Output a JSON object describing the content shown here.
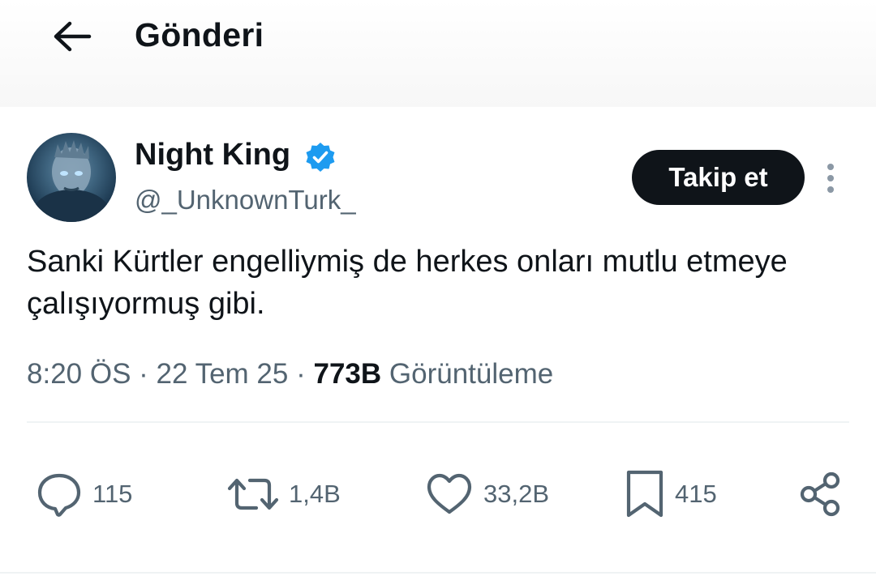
{
  "header": {
    "title": "Gönderi",
    "back_icon": "arrow-left-icon"
  },
  "author": {
    "display_name": "Night King",
    "handle": "@_UnknownTurk_",
    "verified": true,
    "verified_color": "#1d9bf0"
  },
  "follow_button": {
    "label": "Takip et"
  },
  "tweet": {
    "text": "Sanki Kürtler engelliymiş de herkes onları mutlu etmeye çalışıyormuş gibi."
  },
  "meta": {
    "time": "8:20 ÖS",
    "separator": "·",
    "date": "22 Tem 25",
    "views_count": "773B",
    "views_label": "Görüntüleme"
  },
  "actions": {
    "replies": {
      "icon": "reply-icon",
      "count": "115"
    },
    "reposts": {
      "icon": "repost-icon",
      "count": "1,4B"
    },
    "likes": {
      "icon": "heart-icon",
      "count": "33,2B"
    },
    "bookmarks": {
      "icon": "bookmark-icon",
      "count": "415"
    },
    "share": {
      "icon": "share-icon"
    }
  },
  "colors": {
    "text_primary": "#0f1419",
    "text_secondary": "#536471",
    "button_bg": "#0f1419"
  }
}
